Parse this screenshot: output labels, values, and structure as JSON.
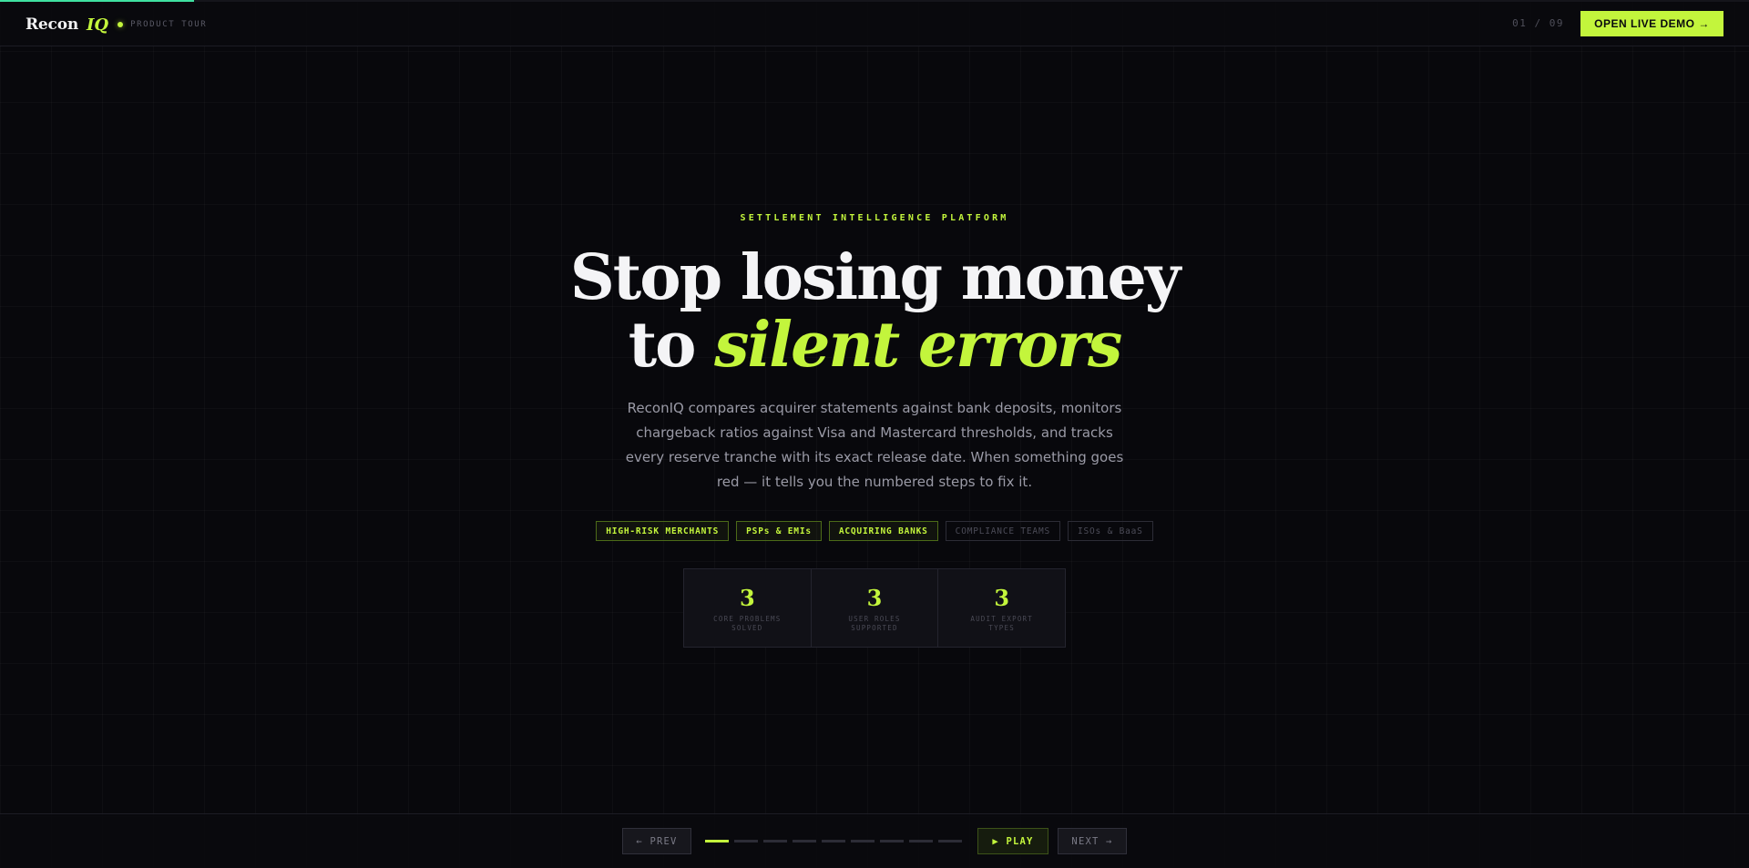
{
  "progress": {
    "fraction": 0.111,
    "color": "#3fe0a0"
  },
  "header": {
    "brand_name": "Recon",
    "brand_mark": "IQ",
    "brand_tag": "PRODUCT TOUR",
    "slide_counter": "01 / 09",
    "demo_button": "OPEN LIVE DEMO →"
  },
  "hero": {
    "eyebrow": "SETTLEMENT INTELLIGENCE PLATFORM",
    "headline_line1": "Stop losing money",
    "headline_line2_plain": "to ",
    "headline_line2_accent": "silent errors",
    "subcopy": "ReconIQ compares acquirer statements against bank deposits, monitors chargeback ratios against Visa and Mastercard thresholds, and tracks every reserve tranche with its exact release date. When something goes red — it tells you the numbered steps to fix it.",
    "chips": [
      {
        "label": "HIGH-RISK MERCHANTS",
        "active": true
      },
      {
        "label": "PSPs & EMIs",
        "active": true
      },
      {
        "label": "ACQUIRING BANKS",
        "active": true
      },
      {
        "label": "COMPLIANCE TEAMS",
        "active": false
      },
      {
        "label": "ISOs & BaaS",
        "active": false
      }
    ],
    "stats": [
      {
        "value": "3",
        "label": "CORE PROBLEMS SOLVED"
      },
      {
        "value": "3",
        "label": "USER ROLES SUPPORTED"
      },
      {
        "value": "3",
        "label": "AUDIT EXPORT TYPES"
      }
    ]
  },
  "footer": {
    "prev_label": "← PREV",
    "play_label": "▶ PLAY",
    "next_label": "NEXT →",
    "slides_total": 9,
    "slide_active": 1
  },
  "colors": {
    "accent": "#c3f53c",
    "background": "#08080c",
    "progress": "#3fe0a0"
  }
}
